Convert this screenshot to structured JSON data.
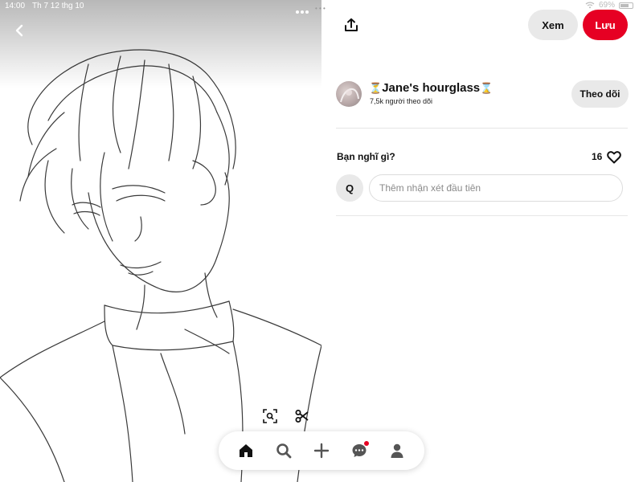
{
  "status_bar": {
    "time": "14:00",
    "date": "Th 7 12 thg 10",
    "battery": "69%"
  },
  "image": {
    "alt": "Sketch of anime-style boy with messy hair and high collar",
    "back_icon": "chevron-left-icon",
    "more_icon": "more-horizontal-icon",
    "lens_icon": "visual-search-icon",
    "scissors_icon": "scissors-icon"
  },
  "bottom_nav": {
    "items": [
      {
        "icon": "home-icon",
        "active": true
      },
      {
        "icon": "search-icon",
        "active": false
      },
      {
        "icon": "plus-icon",
        "active": false
      },
      {
        "icon": "messages-icon",
        "active": false,
        "notification": true
      },
      {
        "icon": "profile-icon",
        "active": false
      }
    ]
  },
  "header": {
    "share_icon": "share-upload-icon",
    "view_label": "Xem",
    "save_label": "Lưu"
  },
  "creator": {
    "name": "Jane's hourglass",
    "prefix_emoji": "⏳",
    "suffix_emoji": "⌛",
    "followers": "7,5k người theo dõi",
    "follow_label": "Theo dõi"
  },
  "comments": {
    "heading": "Bạn nghĩ gì?",
    "like_count": "16",
    "user_initial": "Q",
    "placeholder": "Thêm nhận xét đầu tiên"
  },
  "colors": {
    "accent": "#e60023",
    "pill_gray": "#e9e9e9",
    "text": "#111111"
  }
}
